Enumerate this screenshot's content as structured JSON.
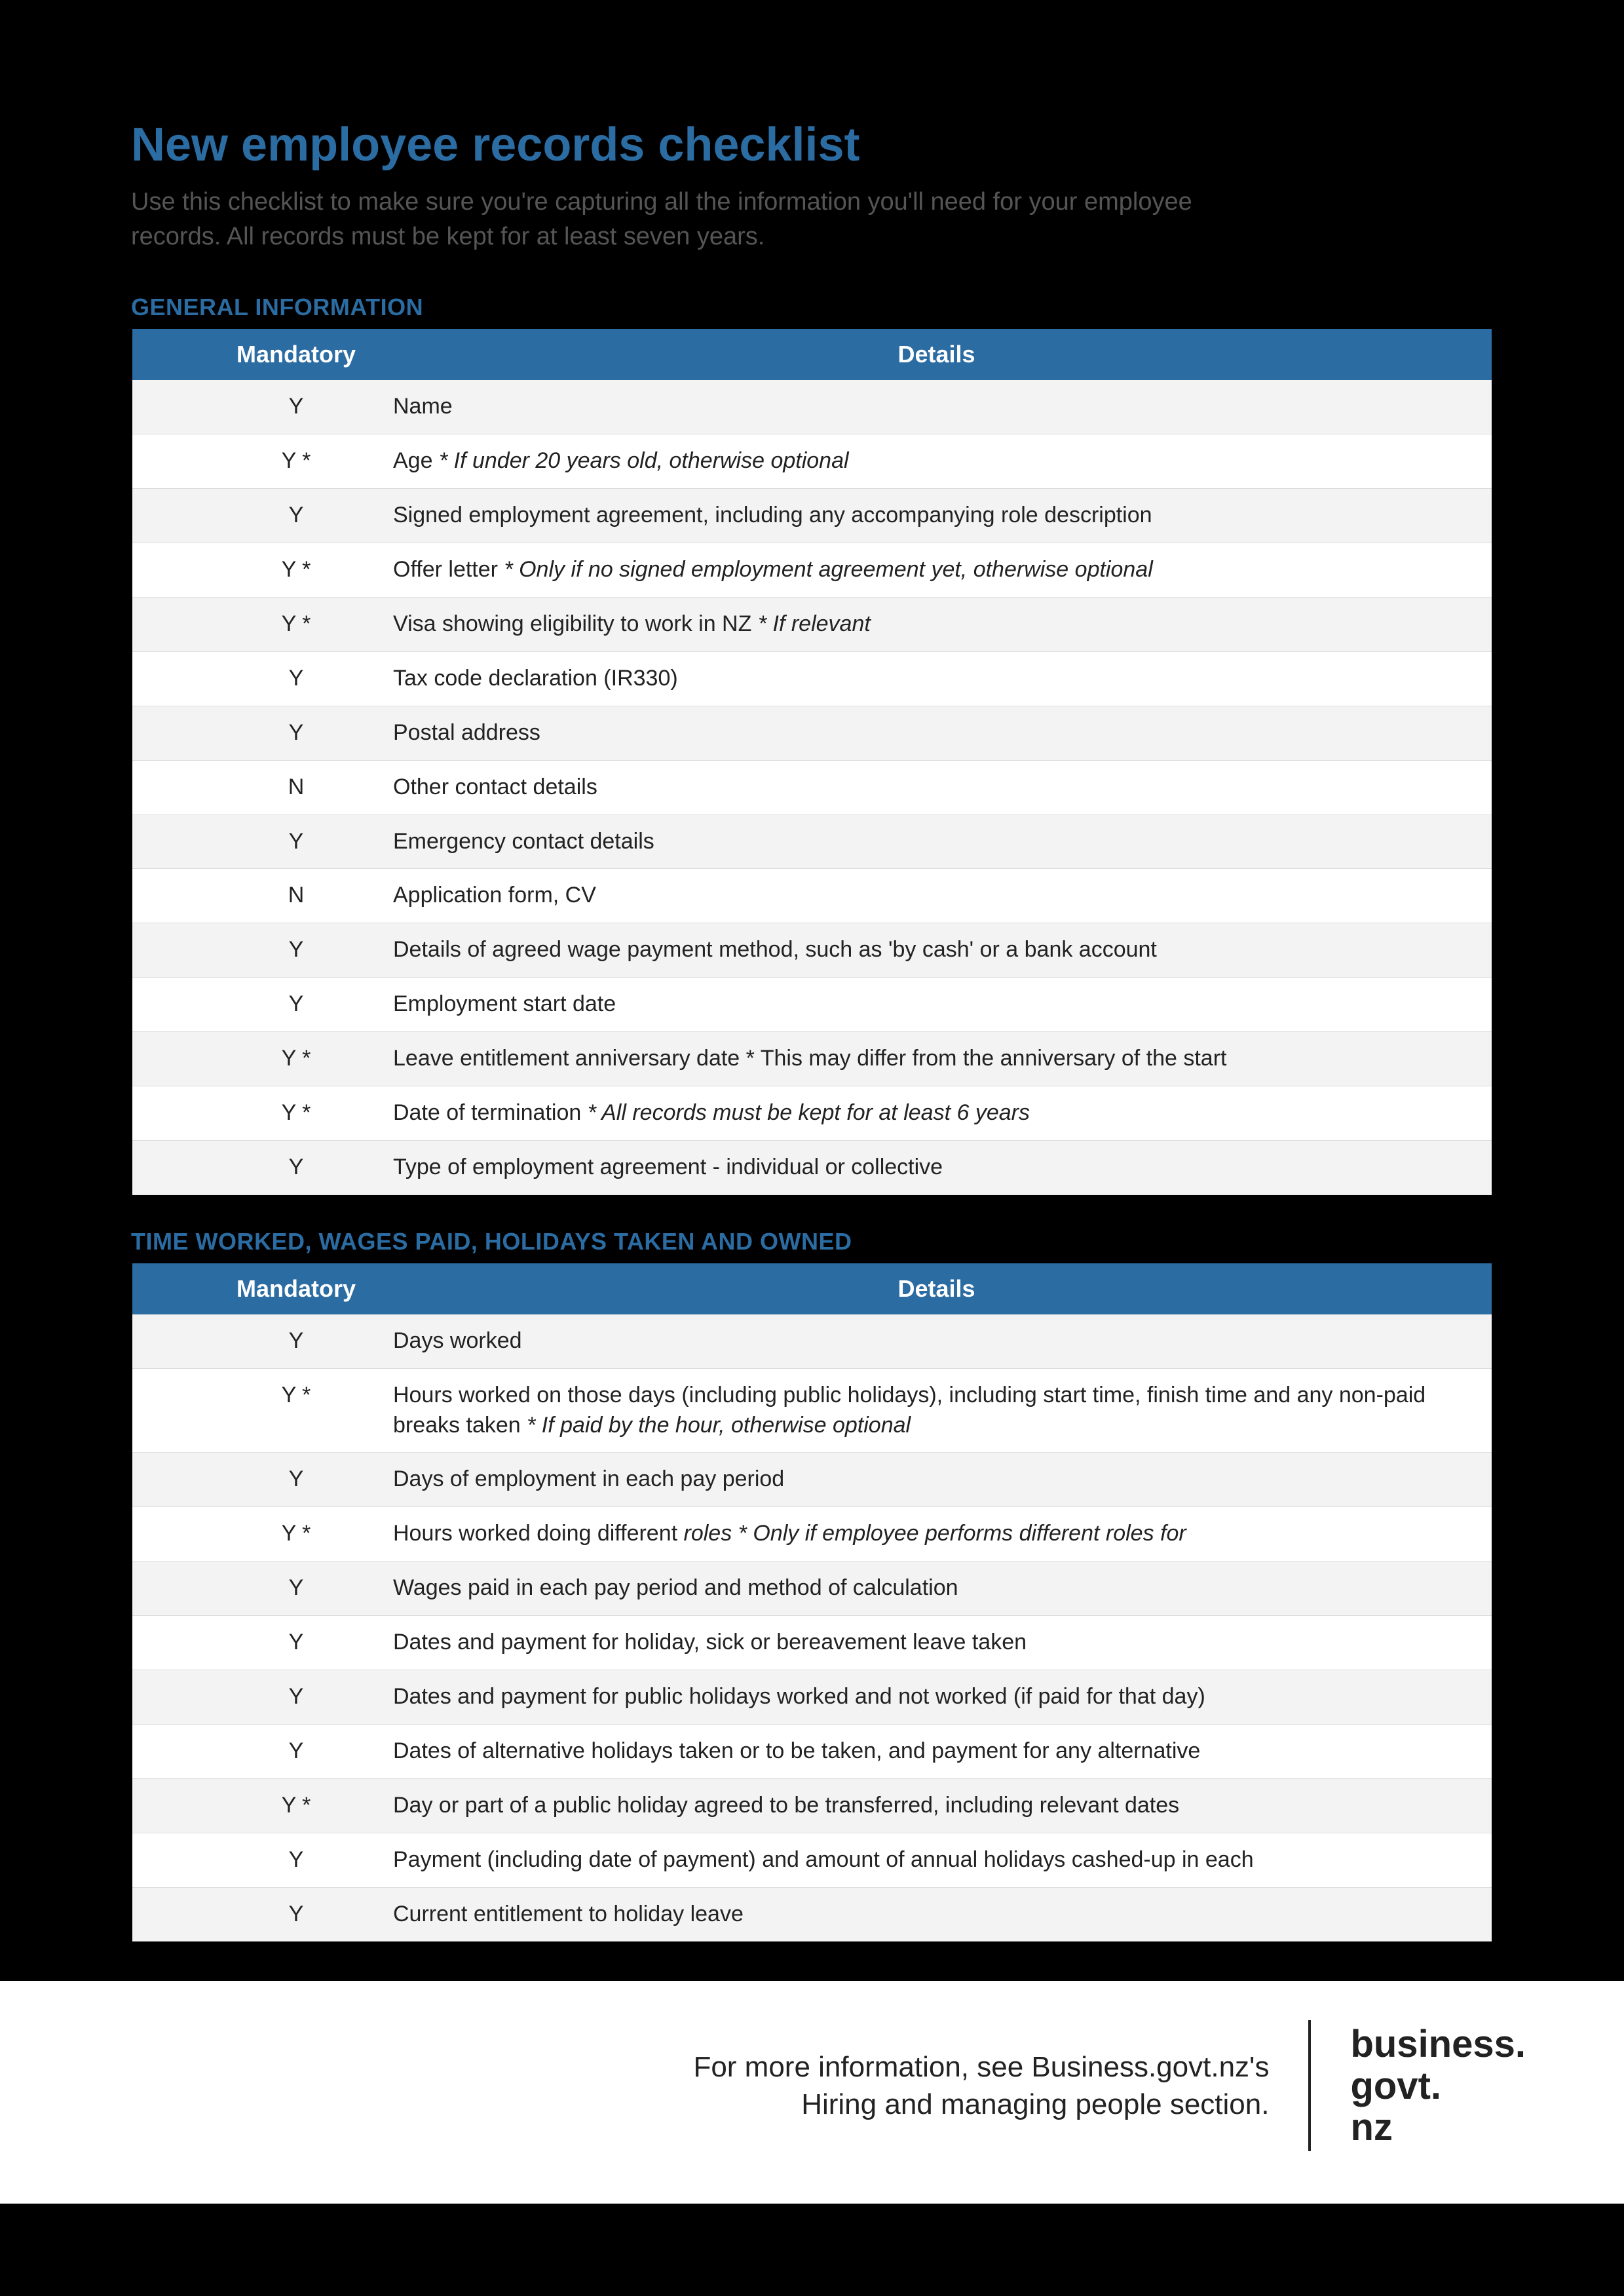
{
  "title": "New employee records checklist",
  "intro": "Use this checklist to make sure you're capturing all the information you'll need for your employee records. All records must be kept for at least seven years.",
  "sections": [
    {
      "heading": "GENERAL INFORMATION",
      "headers": {
        "mandatory": "Mandatory",
        "details": "Details"
      },
      "rows": [
        {
          "mandatory": "Y",
          "details": "Name"
        },
        {
          "mandatory": "Y *",
          "details": "Age  ",
          "note": "* If under 20 years old, otherwise optional"
        },
        {
          "mandatory": "Y",
          "details": "Signed employment agreement, including any accompanying role description"
        },
        {
          "mandatory": "Y *",
          "details": "Offer letter  ",
          "note": "* Only if no signed employment agreement yet, otherwise optional"
        },
        {
          "mandatory": "Y *",
          "details": "Visa showing eligibility to work in NZ  ",
          "note": "* If relevant"
        },
        {
          "mandatory": "Y",
          "details": "Tax code declaration (IR330)"
        },
        {
          "mandatory": "Y",
          "details": "Postal address"
        },
        {
          "mandatory": "N",
          "details": "Other contact details"
        },
        {
          "mandatory": "Y",
          "details": "Emergency contact details"
        },
        {
          "mandatory": "N",
          "details": "Application form, CV"
        },
        {
          "mandatory": "Y",
          "details": "Details of agreed wage payment method, such as 'by cash' or a bank account"
        },
        {
          "mandatory": "Y",
          "details": "Employment start date"
        },
        {
          "mandatory": "Y *",
          "details": "Leave entitlement anniversary date  * This may differ from the anniversary of the start"
        },
        {
          "mandatory": "Y *",
          "details": "Date of termination  ",
          "note": "* All records must be kept for at least 6 years"
        },
        {
          "mandatory": "Y",
          "details": "Type of employment agreement - individual or collective"
        }
      ]
    },
    {
      "heading": "TIME WORKED, WAGES PAID, HOLIDAYS TAKEN AND OWNED",
      "headers": {
        "mandatory": "Mandatory",
        "details": "Details"
      },
      "rows": [
        {
          "mandatory": "Y",
          "details": "Days worked"
        },
        {
          "mandatory": "Y *",
          "details": "Hours worked on those days (including public holidays), including start time, finish time and any non-paid breaks taken  ",
          "note": "* If paid by the hour, otherwise optional",
          "tall": true
        },
        {
          "mandatory": "Y",
          "details": "Days of employment in each pay period"
        },
        {
          "mandatory": "Y *",
          "pre": "Hours worked doing different ",
          "roles": "roles  ",
          "note": "* Only if employee performs different roles for",
          "clip": true
        },
        {
          "mandatory": "Y",
          "details": "Wages paid in each pay period and method of calculation"
        },
        {
          "mandatory": "Y",
          "details": "Dates and payment for holiday, sick or bereavement leave taken"
        },
        {
          "mandatory": "Y",
          "details": "Dates and payment for public holidays worked and not worked (if paid for that day)"
        },
        {
          "mandatory": "Y",
          "details": "Dates of alternative holidays taken or to be taken, and payment for any alternative",
          "clip": true
        },
        {
          "mandatory": "Y *",
          "details": "Day or part of a public holiday agreed to be transferred, including relevant dates",
          "clip": true
        },
        {
          "mandatory": "Y",
          "details": "Payment (including date of payment) and amount of annual holidays cashed-up in each",
          "clip": true
        },
        {
          "mandatory": "Y",
          "details": "Current entitlement to holiday leave"
        }
      ]
    }
  ],
  "footer": {
    "line1": "For more information, see Business.govt.nz's",
    "line2": "Hiring and managing people section.",
    "brand1": "business.",
    "brand2": "govt.",
    "brand3": "nz"
  }
}
